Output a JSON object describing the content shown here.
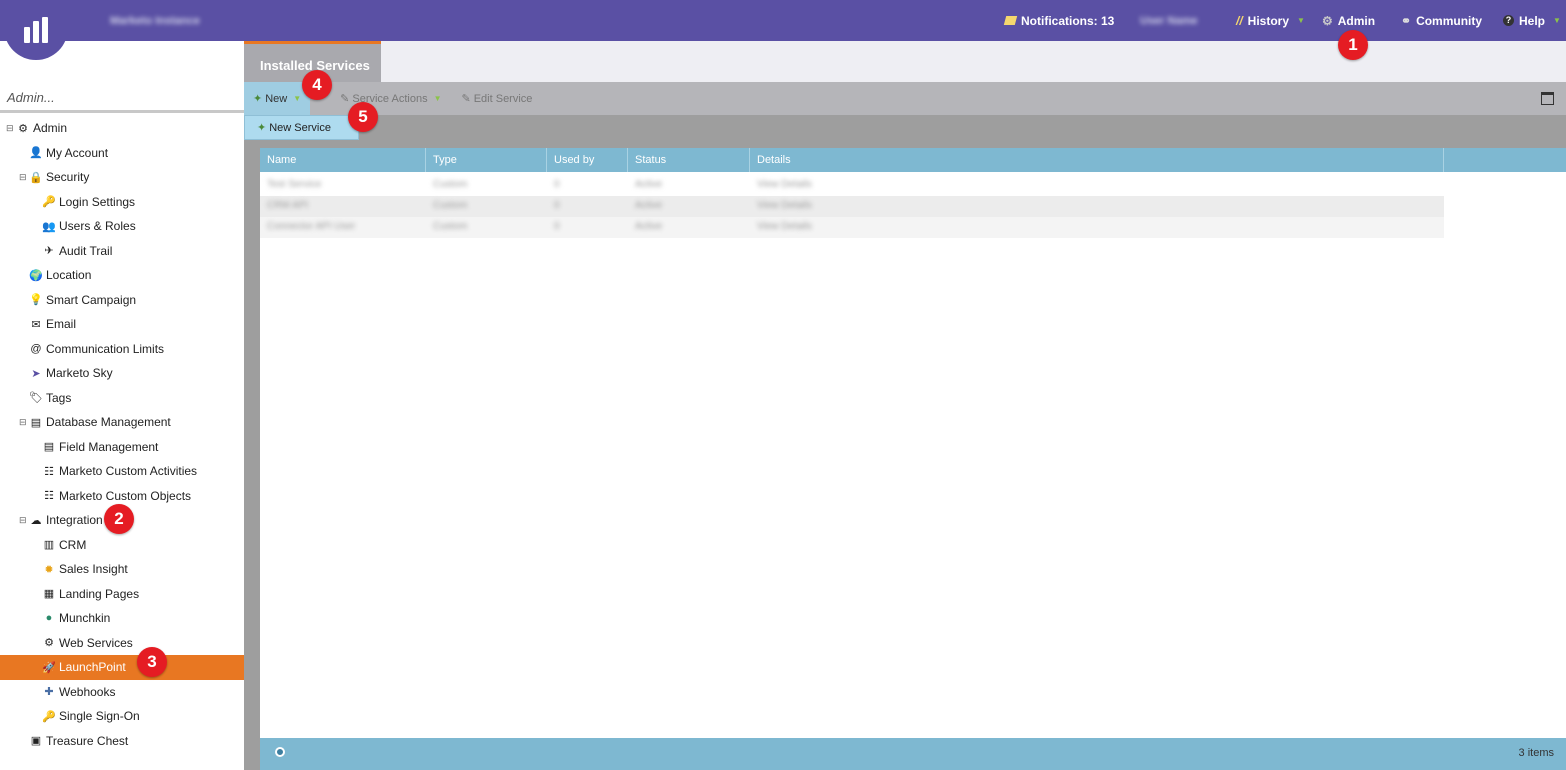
{
  "topbar": {
    "account_name": "Marketo Instance",
    "notifications": "Notifications: 13",
    "user_name": "User Name",
    "history": "History",
    "admin": "Admin",
    "community": "Community",
    "help": "Help"
  },
  "sidebar": {
    "search_placeholder": "Admin...",
    "items": [
      {
        "label": "Admin",
        "icon": "gear-icon"
      },
      {
        "label": "My Account",
        "icon": "user-icon"
      },
      {
        "label": "Security",
        "icon": "lock-icon"
      },
      {
        "label": "Login Settings",
        "icon": "key-icon"
      },
      {
        "label": "Users & Roles",
        "icon": "users-icon"
      },
      {
        "label": "Audit Trail",
        "icon": "audit-icon"
      },
      {
        "label": "Location",
        "icon": "globe-icon"
      },
      {
        "label": "Smart Campaign",
        "icon": "lightbulb-icon"
      },
      {
        "label": "Email",
        "icon": "email-icon"
      },
      {
        "label": "Communication Limits",
        "icon": "at-icon"
      },
      {
        "label": "Marketo Sky",
        "icon": "bird-icon"
      },
      {
        "label": "Tags",
        "icon": "tag-icon"
      },
      {
        "label": "Database Management",
        "icon": "database-icon"
      },
      {
        "label": "Field Management",
        "icon": "field-icon"
      },
      {
        "label": "Marketo Custom Activities",
        "icon": "activity-icon"
      },
      {
        "label": "Marketo Custom Objects",
        "icon": "object-icon"
      },
      {
        "label": "Integration",
        "icon": "cloud-icon"
      },
      {
        "label": "CRM",
        "icon": "crm-icon"
      },
      {
        "label": "Sales Insight",
        "icon": "insight-icon"
      },
      {
        "label": "Landing Pages",
        "icon": "page-icon"
      },
      {
        "label": "Munchkin",
        "icon": "munchkin-icon"
      },
      {
        "label": "Web Services",
        "icon": "webservice-icon"
      },
      {
        "label": "LaunchPoint",
        "icon": "rocket-icon"
      },
      {
        "label": "Webhooks",
        "icon": "webhook-icon"
      },
      {
        "label": "Single Sign-On",
        "icon": "key-icon"
      },
      {
        "label": "Treasure Chest",
        "icon": "chest-icon"
      }
    ]
  },
  "main": {
    "tab_label": "Installed Services",
    "toolbar": {
      "new_label": "New",
      "service_actions_label": "Service Actions",
      "edit_service_label": "Edit Service"
    },
    "dropdown": {
      "new_service_label": "New Service"
    },
    "grid": {
      "columns": [
        "Name",
        "Type",
        "Used by",
        "Status",
        "Details"
      ],
      "rows": [
        [
          "Test Service",
          "Custom",
          "0",
          "Active",
          "View Details"
        ],
        [
          "CRM API",
          "Custom",
          "0",
          "Active",
          "View Details"
        ],
        [
          "Connector API User",
          "Custom",
          "0",
          "Active",
          "View Details"
        ]
      ]
    },
    "footer_count": "3 items"
  },
  "callouts": [
    "1",
    "2",
    "3",
    "4",
    "5"
  ],
  "colors": {
    "brand_purple": "#5a50a4",
    "accent_orange": "#e87722",
    "grid_blue": "#7eb8d1",
    "callout_red": "#e51c23"
  }
}
